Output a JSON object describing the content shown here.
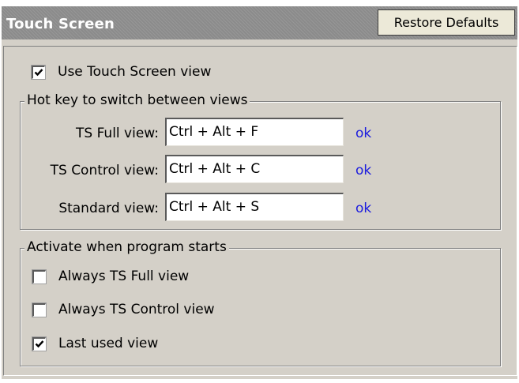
{
  "header": {
    "title": "Touch Screen",
    "restore_label": "Restore Defaults"
  },
  "use_ts_view": {
    "label": "Use Touch Screen view",
    "checked": true
  },
  "hotkeys": {
    "legend": "Hot key to switch between views",
    "rows": [
      {
        "label": "TS Full view:",
        "value": "Ctrl + Alt + F",
        "status": "ok"
      },
      {
        "label": "TS Control view:",
        "value": "Ctrl + Alt + C",
        "status": "ok"
      },
      {
        "label": "Standard view:",
        "value": "Ctrl + Alt + S",
        "status": "ok"
      }
    ]
  },
  "activate": {
    "legend": "Activate when program starts",
    "options": [
      {
        "label": "Always TS Full view",
        "checked": false
      },
      {
        "label": "Always TS Control view",
        "checked": false
      },
      {
        "label": "Last used view",
        "checked": true
      }
    ]
  },
  "colors": {
    "panel_bg": "#d4d0c8",
    "header_bg": "#8b8b8b",
    "link": "#1c1cde"
  }
}
